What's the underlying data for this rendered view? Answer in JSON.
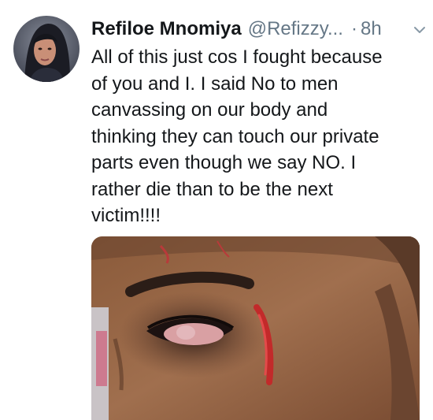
{
  "tweet": {
    "author_name": "Refiloe Mnomiya",
    "handle": "@Refizzy...",
    "separator": "·",
    "time": "8h",
    "text_lines": [
      "All of this just cos I fought because",
      "of you and I.  I said No to men",
      "canvassing on our body and",
      "thinking they can touch our private",
      "parts even though we say NO. I",
      "rather die than to be the next",
      "victim!!!!"
    ]
  },
  "icons": {
    "menu": "chevron-down-icon",
    "avatar": "profile-photo"
  },
  "colors": {
    "name": "#14171a",
    "secondary": "#657786",
    "text": "#14171a"
  }
}
